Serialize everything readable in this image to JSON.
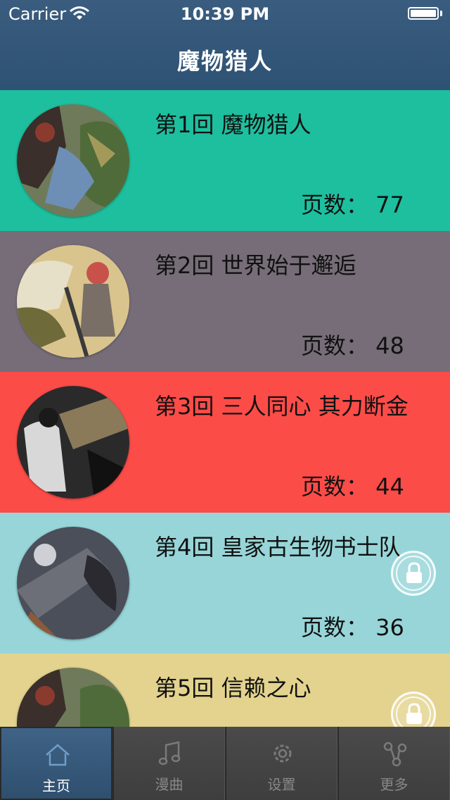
{
  "status_bar": {
    "carrier": "Carrier",
    "time": "10:39 PM"
  },
  "nav": {
    "title": "魔物猎人"
  },
  "chapters": [
    {
      "title": "第1回 魔物猎人",
      "pages": "页数： 77",
      "color": "#1dbf9f",
      "locked": false
    },
    {
      "title": "第2回 世界始于邂逅",
      "pages": "页数： 48",
      "color": "#766d78",
      "locked": false
    },
    {
      "title": "第3回 三人同心 其力断金",
      "pages": "页数： 44",
      "color": "#fc4c48",
      "locked": false
    },
    {
      "title": "第4回 皇家古生物书士队",
      "pages": "页数： 36",
      "color": "#97d5d8",
      "locked": true
    },
    {
      "title": "第5回 信赖之心",
      "pages": "",
      "color": "#e3d38e",
      "locked": true
    }
  ],
  "tabs": [
    {
      "label": "主页",
      "icon": "home-icon",
      "active": true
    },
    {
      "label": "漫曲",
      "icon": "music-note-icon",
      "active": false
    },
    {
      "label": "设置",
      "icon": "gear-icon",
      "active": false
    },
    {
      "label": "更多",
      "icon": "share-nodes-icon",
      "active": false
    }
  ]
}
